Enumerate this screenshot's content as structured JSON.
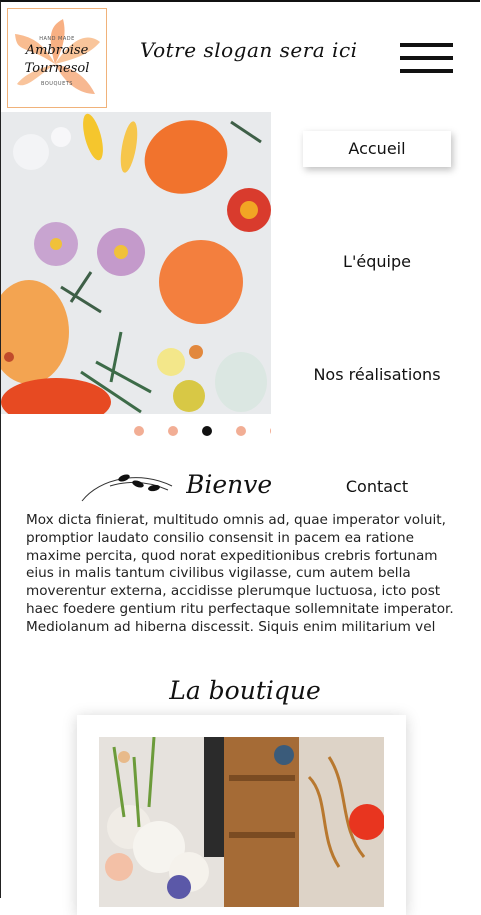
{
  "logo": {
    "top_text": "HAND MADE",
    "brand_line1": "Ambroise",
    "brand_line2": "Tournesol",
    "bottom_text": "BOUQUETS"
  },
  "header": {
    "slogan": "Votre slogan sera ici"
  },
  "nav": {
    "items": [
      "Accueil",
      "L'équipe",
      "Nos réalisations",
      "Contact"
    ],
    "active": "Accueil"
  },
  "carousel": {
    "slide_count": 5,
    "active_index": 2
  },
  "welcome": {
    "title": "Bienvenue",
    "paragraph": "Mox dicta finierat, multitudo omnis ad, quae imperator voluit, promptior laudato consilio consensit in pacem ea ratione maxime percita, quod norat expeditionibus crebris fortunam eius in malis tantum civilibus vigilasse, cum autem bella moverentur externa, accidisse plerumque luctuosa, icto post haec foedere gentium ritu perfectaque sollemnitate imperator. Mediolanum ad hiberna discessit. Siquis enim militarium vel honoratorum aut nobilis inter suos"
  },
  "shop": {
    "title": "La boutique"
  },
  "colors": {
    "accent_peach": "#f2ae95",
    "logo_border": "#f0b27a",
    "text": "#111111"
  }
}
